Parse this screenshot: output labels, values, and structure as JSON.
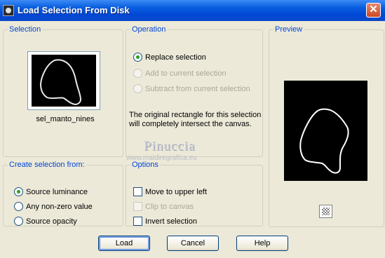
{
  "window": {
    "title": "Load Selection From Disk",
    "close_label": "✕"
  },
  "selection": {
    "legend": "Selection",
    "file_name": "sel_manto_nines"
  },
  "operation": {
    "legend": "Operation",
    "options": [
      {
        "label": "Replace selection",
        "checked": true,
        "enabled": true
      },
      {
        "label": "Add to current selection",
        "checked": false,
        "enabled": false
      },
      {
        "label": "Subtract from current selection",
        "checked": false,
        "enabled": false
      }
    ],
    "info": "The original rectangle for this selection will completely intersect the canvas."
  },
  "preview": {
    "legend": "Preview",
    "toggle_icon": "checkerboard-icon"
  },
  "create_from": {
    "legend": "Create selection from:",
    "options": [
      {
        "label": "Source luminance",
        "checked": true
      },
      {
        "label": "Any non-zero value",
        "checked": false
      },
      {
        "label": "Source opacity",
        "checked": false
      }
    ]
  },
  "options": {
    "legend": "Options",
    "items": [
      {
        "label": "Move to upper left",
        "checked": false,
        "enabled": true
      },
      {
        "label": "Clip to canvas",
        "checked": false,
        "enabled": false
      },
      {
        "label": "Invert selection",
        "checked": false,
        "enabled": true
      }
    ]
  },
  "watermark": {
    "title": "Pinuccia",
    "url": "www.maidiregrafica.eu"
  },
  "buttons": {
    "load": "Load",
    "cancel": "Cancel",
    "help": "Help"
  }
}
